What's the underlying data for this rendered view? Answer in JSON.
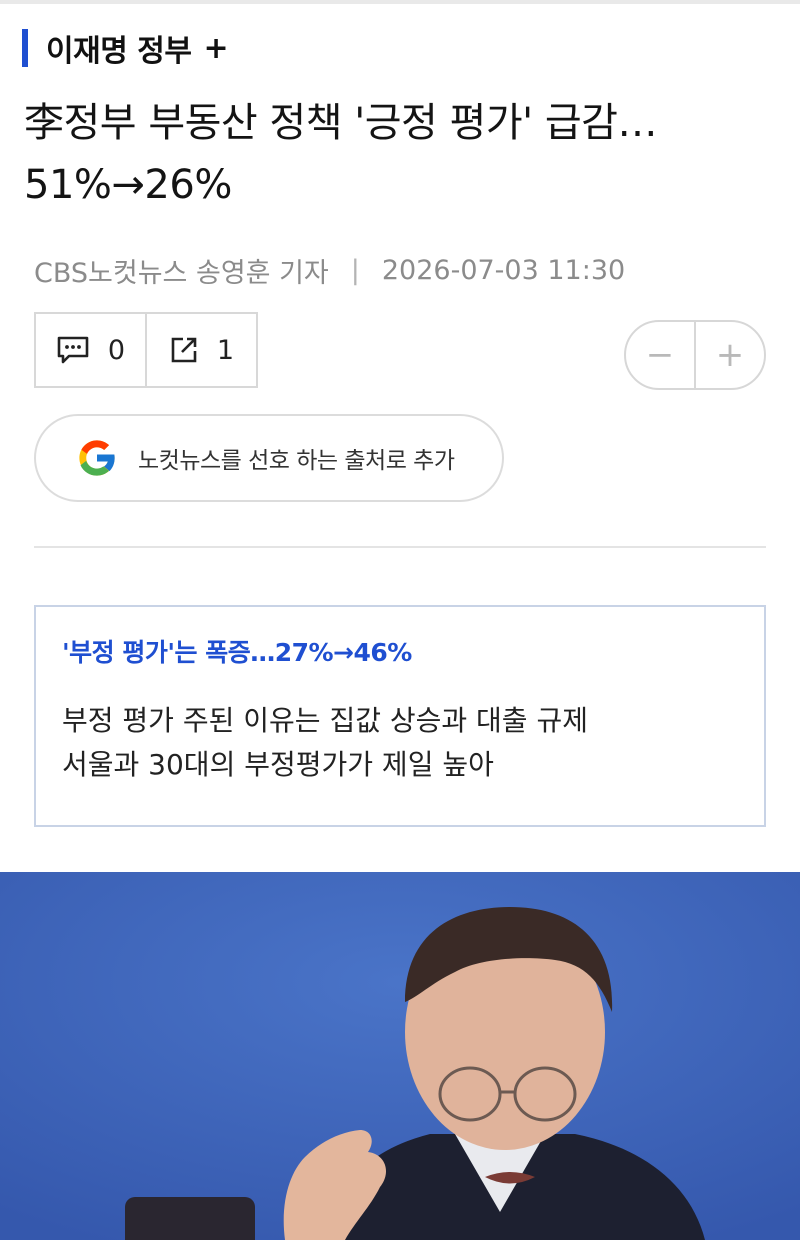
{
  "section": {
    "label": "이재명 정부",
    "plus": "+"
  },
  "headline": {
    "line1": "李정부 부동산 정책 '긍정 평가' 급감…",
    "line2": "51%→26%"
  },
  "byline": {
    "reporter": "CBS노컷뉴스 송영훈 기자",
    "separator": "|",
    "datetime": "2026-07-03 11:30"
  },
  "counters": {
    "comments": {
      "icon": "comment-icon",
      "count": "0"
    },
    "shares": {
      "icon": "share-icon",
      "count": "1"
    }
  },
  "font_size": {
    "decrease": "−",
    "increase": "+"
  },
  "google": {
    "icon": "google-g-icon",
    "label": "노컷뉴스를 선호 하는 출처로 추가"
  },
  "summary": {
    "headline": "'부정 평가'는 폭증…27%→46%",
    "lines": [
      "부정 평가 주된 이유는 집값 상승과 대출 규제",
      "서울과 30대의 부정평가가 제일 높아"
    ]
  },
  "colors": {
    "accent": "#1f4fd1",
    "photo_bg": "#3f66bd"
  }
}
